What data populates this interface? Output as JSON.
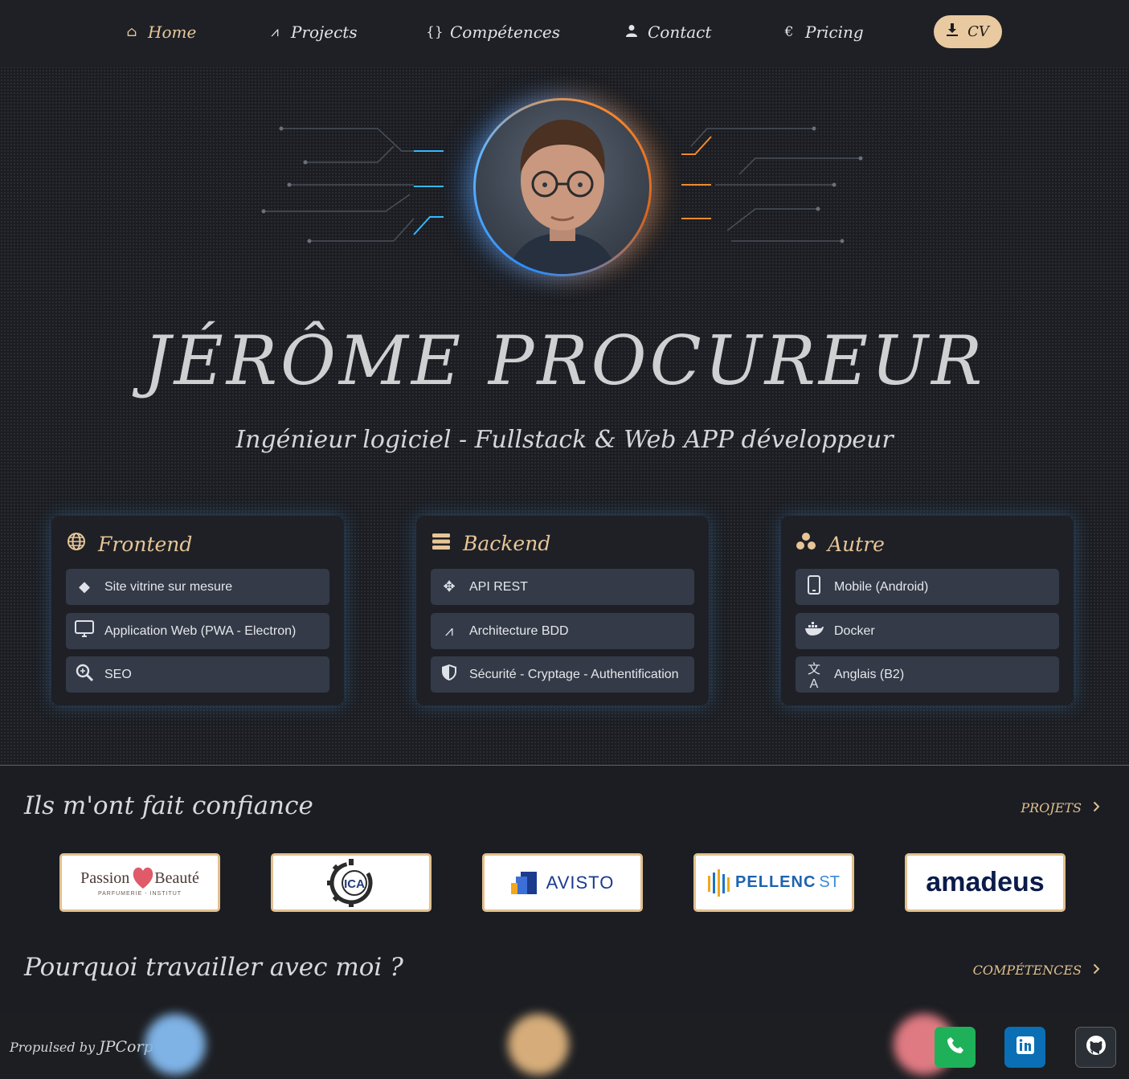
{
  "nav": {
    "items": [
      {
        "label": "Home",
        "icon": "home-icon",
        "glyph": "⌂"
      },
      {
        "label": "Projects",
        "icon": "compass-icon",
        "glyph": "⩘"
      },
      {
        "label": "Compétences",
        "icon": "code-braces-icon",
        "glyph": "{}"
      },
      {
        "label": "Contact",
        "icon": "user-icon",
        "glyph": "●"
      },
      {
        "label": "Pricing",
        "icon": "euro-icon",
        "glyph": "€"
      }
    ],
    "cv_label": "CV",
    "cv_icon": "⤓"
  },
  "hero": {
    "name": "JÉRÔME PROCUREUR",
    "subtitle": "Ingénieur logiciel - Fullstack & Web APP développeur"
  },
  "cards": [
    {
      "title": "Frontend",
      "icon": "globe-icon",
      "glyph": "◍",
      "items": [
        {
          "label": "Site vitrine sur mesure",
          "icon": "diamond-icon",
          "glyph": "◆"
        },
        {
          "label": "Application Web (PWA - Electron)",
          "icon": "monitor-icon",
          "glyph": "▭"
        },
        {
          "label": "SEO",
          "icon": "magnifier-icon",
          "glyph": "⚲"
        }
      ]
    },
    {
      "title": "Backend",
      "icon": "server-icon",
      "glyph": "☰",
      "items": [
        {
          "label": "API REST",
          "icon": "network-icon",
          "glyph": "✥"
        },
        {
          "label": "Architecture BDD",
          "icon": "compass-icon",
          "glyph": "⩘"
        },
        {
          "label": "Sécurité - Cryptage - Authentification",
          "icon": "shield-icon",
          "glyph": "⛨"
        }
      ]
    },
    {
      "title": "Autre",
      "icon": "circles-icon",
      "glyph": "⁂",
      "items": [
        {
          "label": "Mobile (Android)",
          "icon": "phone-icon",
          "glyph": "▯"
        },
        {
          "label": "Docker",
          "icon": "docker-icon",
          "glyph": "⛴"
        },
        {
          "label": "Anglais (B2)",
          "icon": "translate-icon",
          "glyph": "文A"
        }
      ]
    }
  ],
  "trust": {
    "title": "Ils m'ont fait confiance",
    "link_label": "PROJETS",
    "logos": [
      {
        "name": "Passion Beauté",
        "sub": "PARFUMERIE - INSTITUT"
      },
      {
        "name": "ICA"
      },
      {
        "name": "AVISTO"
      },
      {
        "name": "PELLENC",
        "suffix": "ST"
      },
      {
        "name": "amadeus"
      }
    ]
  },
  "why": {
    "title": "Pourquoi travailler avec moi ?",
    "link_label": "COMPÉTENCES"
  },
  "footer": {
    "prefix": "Propulsed by",
    "brand": "JPCorp"
  },
  "colors": {
    "accent": "#e9c99f",
    "pill": "#343a48",
    "card": "#1e2026",
    "phone": "#1fb159",
    "linkedin": "#0a6fb5",
    "github": "#2b2f36"
  }
}
